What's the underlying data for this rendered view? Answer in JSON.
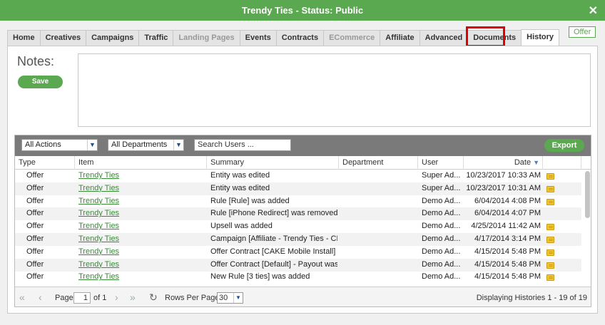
{
  "window": {
    "title": "Trendy Ties - Status: Public",
    "close": "✕"
  },
  "badge": "Offer",
  "tabs": [
    {
      "label": "Home",
      "state": "normal"
    },
    {
      "label": "Creatives",
      "state": "normal"
    },
    {
      "label": "Campaigns",
      "state": "normal"
    },
    {
      "label": "Traffic",
      "state": "normal"
    },
    {
      "label": "Landing Pages",
      "state": "disabled"
    },
    {
      "label": "Events",
      "state": "normal"
    },
    {
      "label": "Contracts",
      "state": "normal"
    },
    {
      "label": "ECommerce",
      "state": "disabled"
    },
    {
      "label": "Affiliate",
      "state": "normal"
    },
    {
      "label": "Advanced",
      "state": "normal"
    },
    {
      "label": "Documents",
      "state": "normal"
    },
    {
      "label": "History",
      "state": "active"
    }
  ],
  "notes": {
    "label": "Notes:",
    "save": "Save",
    "value": ""
  },
  "toolbar": {
    "actions_select": "All Actions",
    "departments_select": "All Departments",
    "search_placeholder": "Search Users ...",
    "export": "Export"
  },
  "columns": [
    "Type",
    "Item",
    "Summary",
    "Department",
    "User",
    "Date"
  ],
  "rows": [
    {
      "type": "Offer",
      "item": "Trendy Ties",
      "summary": "Entity was edited",
      "department": "",
      "user": "Super Ad...",
      "date": "10/23/2017 10:33 AM",
      "has_note": true
    },
    {
      "type": "Offer",
      "item": "Trendy Ties",
      "summary": "Entity was edited",
      "department": "",
      "user": "Super Ad...",
      "date": "10/23/2017 10:31 AM",
      "has_note": true
    },
    {
      "type": "Offer",
      "item": "Trendy Ties",
      "summary": "Rule [Rule] was added",
      "department": "",
      "user": "Demo Ad...",
      "date": "6/04/2014 4:08 PM",
      "has_note": true
    },
    {
      "type": "Offer",
      "item": "Trendy Ties",
      "summary": "Rule [iPhone Redirect] was removed",
      "department": "",
      "user": "Demo Ad...",
      "date": "6/04/2014 4:07 PM",
      "has_note": false
    },
    {
      "type": "Offer",
      "item": "Trendy Ties",
      "summary": "Upsell was added",
      "department": "",
      "user": "Demo Ad...",
      "date": "4/25/2014 11:42 AM",
      "has_note": true
    },
    {
      "type": "Offer",
      "item": "Trendy Ties",
      "summary": "Campaign [Affiliate - Trendy Ties - CP...",
      "department": "",
      "user": "Demo Ad...",
      "date": "4/17/2014 3:14 PM",
      "has_note": true
    },
    {
      "type": "Offer",
      "item": "Trendy Ties",
      "summary": "Offer Contract [CAKE Mobile Install] - ...",
      "department": "",
      "user": "Demo Ad...",
      "date": "4/15/2014 5:48 PM",
      "has_note": true
    },
    {
      "type": "Offer",
      "item": "Trendy Ties",
      "summary": "Offer Contract [Default] - Payout was ...",
      "department": "",
      "user": "Demo Ad...",
      "date": "4/15/2014 5:48 PM",
      "has_note": true
    },
    {
      "type": "Offer",
      "item": "Trendy Ties",
      "summary": "New Rule [3 ties] was added",
      "department": "",
      "user": "Demo Ad...",
      "date": "4/15/2014 5:48 PM",
      "has_note": true
    }
  ],
  "pager": {
    "first": "«",
    "prev": "‹",
    "page_label": "Page",
    "page_value": "1",
    "of_label": "of 1",
    "next": "›",
    "last": "»",
    "refresh": "↻",
    "rows_per_page_label": "Rows Per Page:",
    "rows_per_page": "30",
    "display_text": "Displaying Histories 1 - 19 of 19"
  },
  "colors": {
    "brand": "#5aa84f",
    "highlight": "#e00000",
    "link": "#3a8a3a"
  }
}
